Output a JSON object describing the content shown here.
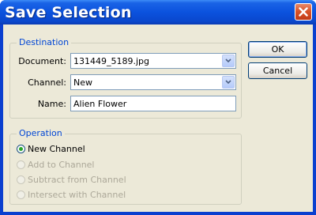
{
  "window": {
    "title": "Save Selection"
  },
  "destination": {
    "legend": "Destination",
    "document_label": "Document:",
    "document_value": "131449_5189.jpg",
    "channel_label": "Channel:",
    "channel_value": "New",
    "name_label": "Name:",
    "name_value": "Alien Flower"
  },
  "operation": {
    "legend": "Operation",
    "options": [
      {
        "label": "New Channel",
        "selected": true,
        "enabled": true
      },
      {
        "label": "Add to Channel",
        "selected": false,
        "enabled": false
      },
      {
        "label": "Subtract from Channel",
        "selected": false,
        "enabled": false
      },
      {
        "label": "Intersect with Channel",
        "selected": false,
        "enabled": false
      }
    ]
  },
  "buttons": {
    "ok": "OK",
    "cancel": "Cancel"
  },
  "icons": {
    "close": "close-icon",
    "dropdown": "chevron-down-icon"
  },
  "colors": {
    "titlebar": "#0b52de",
    "legend": "#0046d5",
    "close": "#d9542a"
  }
}
